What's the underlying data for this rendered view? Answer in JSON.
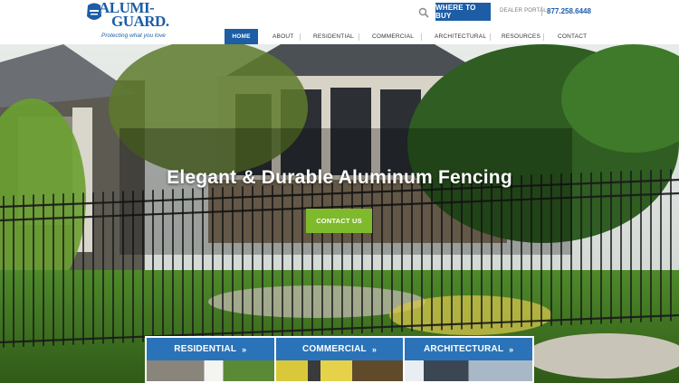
{
  "brand": {
    "name_line1": "ALUMI-",
    "name_line2": "GUARD.",
    "tagline": "Protecting what you love"
  },
  "header": {
    "search_icon": "search-icon",
    "where_to_buy": "WHERE TO BUY",
    "dealer_portal": "DEALER PORTAL",
    "phone": "877.258.6448"
  },
  "nav": {
    "items": [
      {
        "label": "HOME",
        "active": true
      },
      {
        "label": "ABOUT",
        "active": false
      },
      {
        "label": "RESIDENTIAL",
        "active": false
      },
      {
        "label": "COMMERCIAL",
        "active": false
      },
      {
        "label": "ARCHITECTURAL",
        "active": false
      },
      {
        "label": "RESOURCES",
        "active": false
      },
      {
        "label": "CONTACT",
        "active": false
      }
    ]
  },
  "hero": {
    "headline": "Elegant & Durable Aluminum Fencing",
    "cta_label": "CONTACT US"
  },
  "cards": [
    {
      "label": "RESIDENTIAL",
      "arrow": "»"
    },
    {
      "label": "COMMERCIAL",
      "arrow": "»"
    },
    {
      "label": "ARCHITECTURAL",
      "arrow": "»"
    }
  ],
  "colors": {
    "brand_blue": "#1c5da6",
    "cta_green": "#7fba2c"
  }
}
